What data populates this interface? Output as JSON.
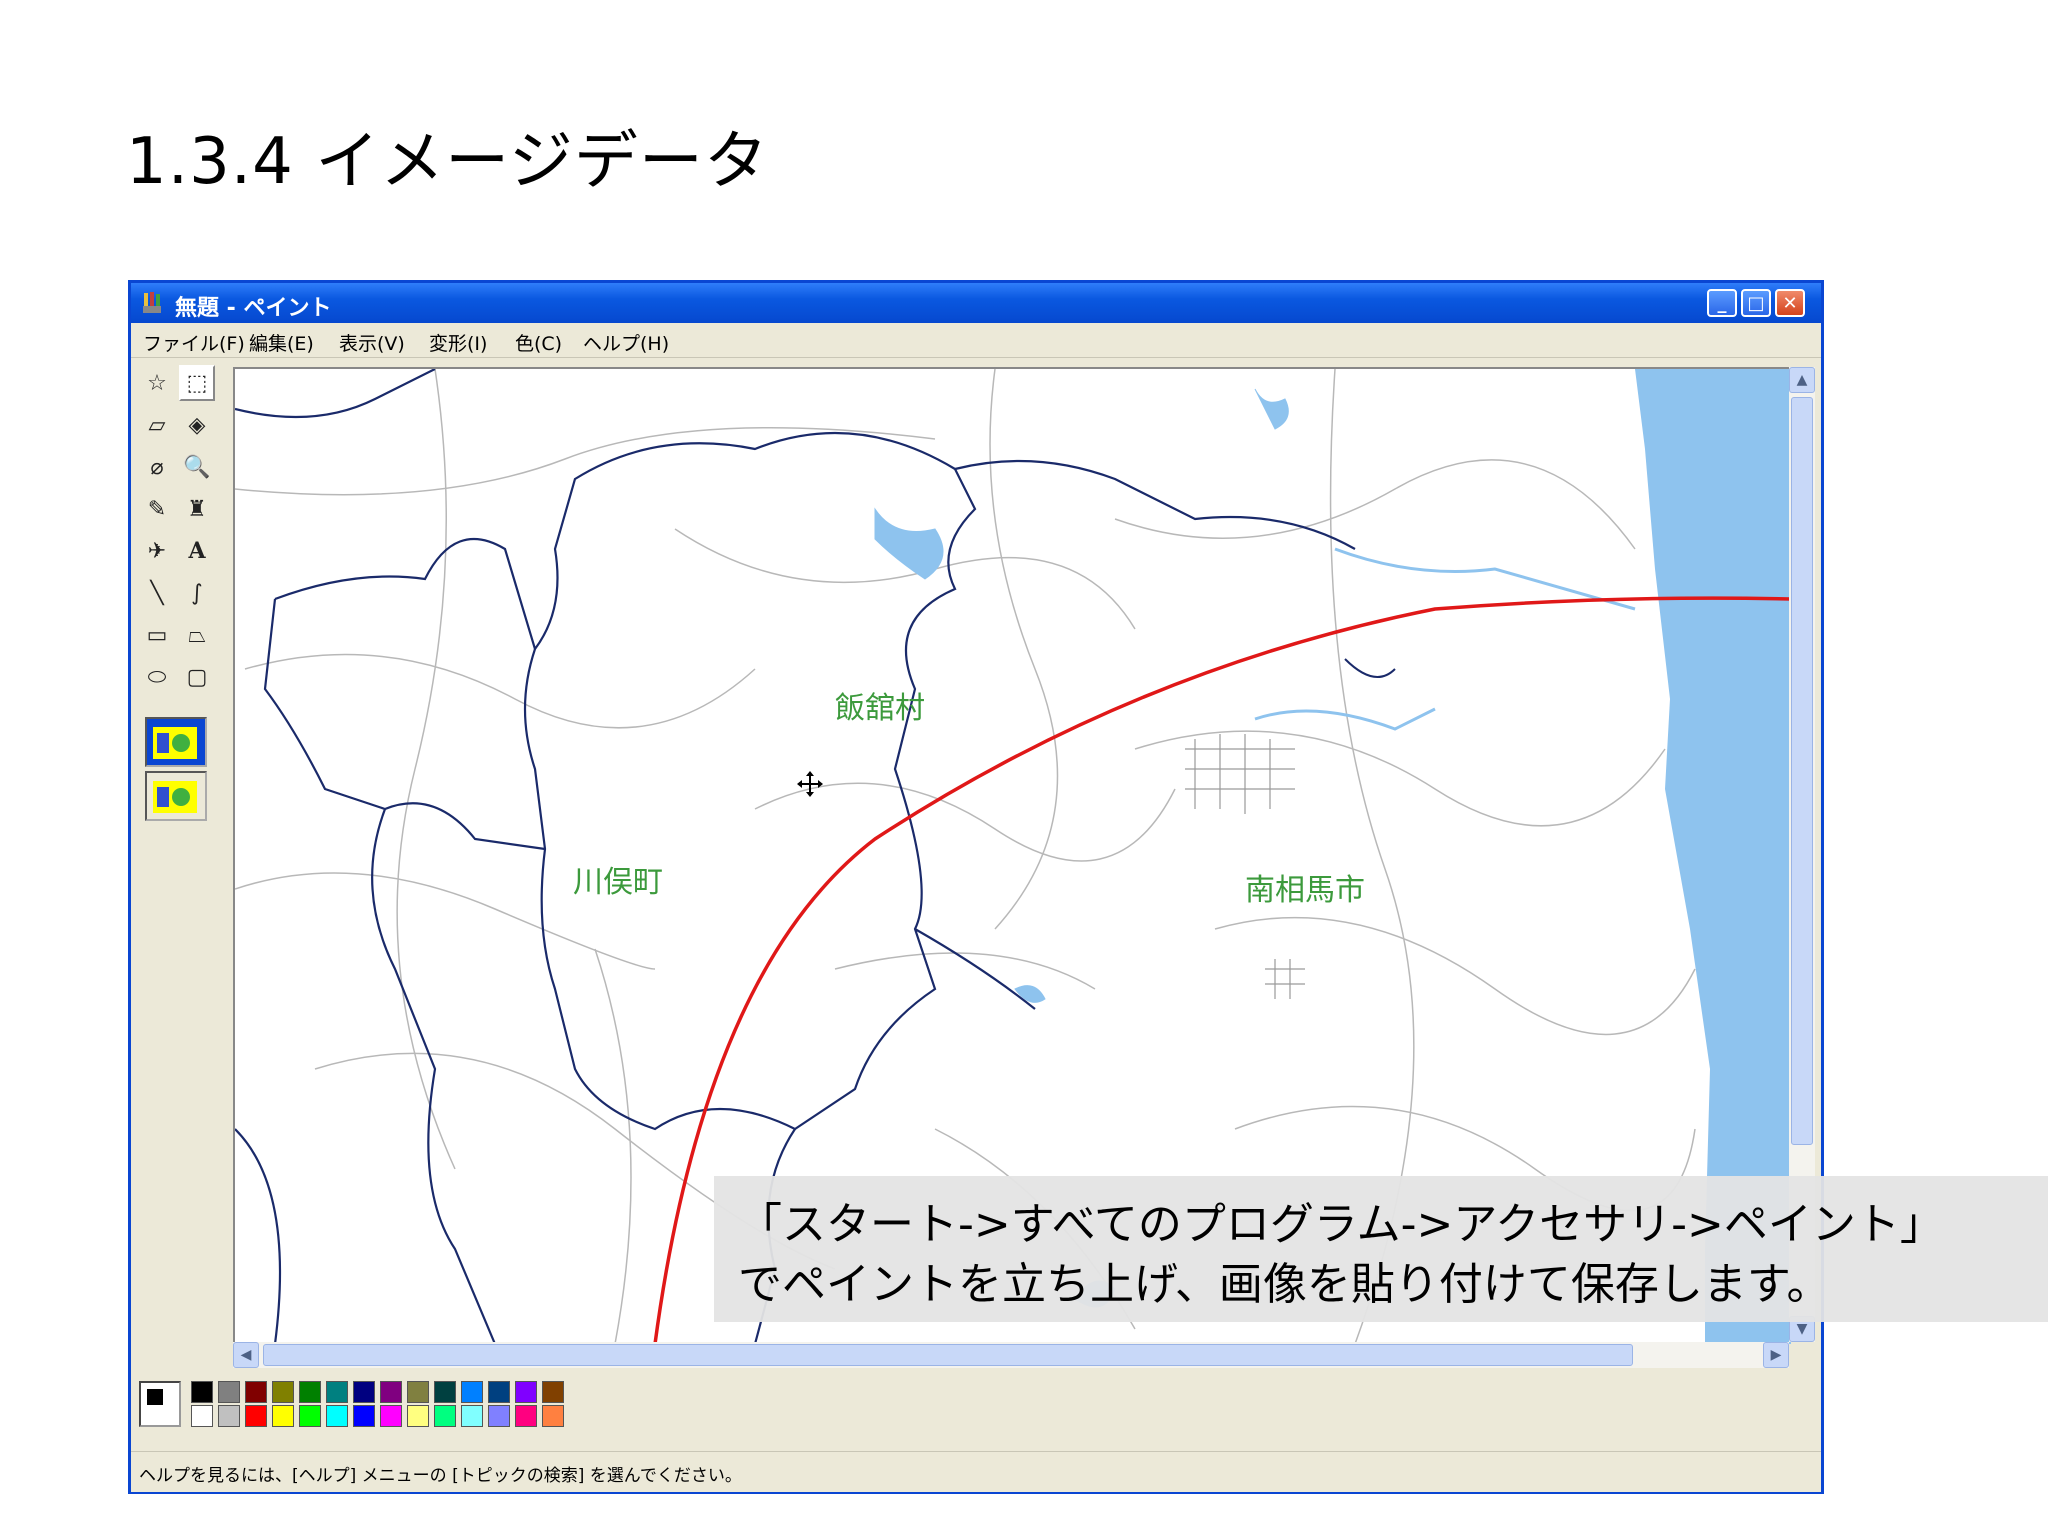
{
  "slide": {
    "title": "1.3.4 イメージデータ"
  },
  "window": {
    "title": "無題 - ペイント",
    "controls": {
      "minimize": "_",
      "maximize": "□",
      "close": "✕"
    }
  },
  "menu": [
    "ファイル(F)",
    "編集(E)",
    "表示(V)",
    "変形(I)",
    "色(C)",
    "ヘルプ(H)"
  ],
  "tools": [
    {
      "name": "free-select-tool",
      "glyph": "☆"
    },
    {
      "name": "rect-select-tool",
      "glyph": "⬚"
    },
    {
      "name": "eraser-tool",
      "glyph": "▱"
    },
    {
      "name": "fill-tool",
      "glyph": "◈"
    },
    {
      "name": "color-picker-tool",
      "glyph": "⌀"
    },
    {
      "name": "magnifier-tool",
      "glyph": "🔍"
    },
    {
      "name": "pencil-tool",
      "glyph": "✎"
    },
    {
      "name": "brush-tool",
      "glyph": "♜"
    },
    {
      "name": "airbrush-tool",
      "glyph": "✈"
    },
    {
      "name": "text-tool",
      "glyph": "A"
    },
    {
      "name": "line-tool",
      "glyph": "╲"
    },
    {
      "name": "curve-tool",
      "glyph": "∫"
    },
    {
      "name": "rectangle-tool",
      "glyph": "▭"
    },
    {
      "name": "polygon-tool",
      "glyph": "⏢"
    },
    {
      "name": "ellipse-tool",
      "glyph": "⬭"
    },
    {
      "name": "rounded-rect-tool",
      "glyph": "▢"
    }
  ],
  "map": {
    "labels": [
      "飯舘村",
      "川俣町",
      "南相馬市"
    ],
    "cursor_icon": "move-cursor-icon"
  },
  "palette": {
    "row1": [
      "#000000",
      "#808080",
      "#800000",
      "#808000",
      "#008000",
      "#008080",
      "#000080",
      "#800080",
      "#808040",
      "#004040",
      "#0080ff",
      "#004080",
      "#8000ff",
      "#804000"
    ],
    "row2": [
      "#ffffff",
      "#c0c0c0",
      "#ff0000",
      "#ffff00",
      "#00ff00",
      "#00ffff",
      "#0000ff",
      "#ff00ff",
      "#ffff80",
      "#00ff80",
      "#80ffff",
      "#8080ff",
      "#ff0080",
      "#ff8040"
    ]
  },
  "status": "ヘルプを見るには、[ヘルプ] メニューの [トピックの検索] を選んでください。",
  "caption": {
    "line1": "「スタート->すべてのプログラム->アクセサリ->ペイント」",
    "line2": "でペイントを立ち上げ、画像を貼り付けて保存します。"
  },
  "colors": {
    "accent": "#0a46d2",
    "sea": "#8ec3ee",
    "route": "#e01818",
    "label": "#3c9a3c"
  }
}
